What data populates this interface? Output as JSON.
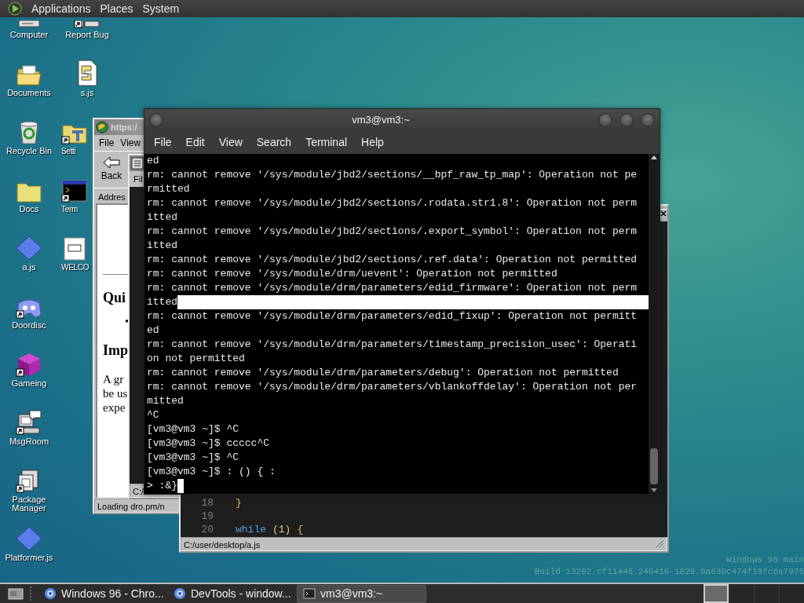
{
  "top_panel": {
    "menus": [
      "Applications",
      "Places",
      "System"
    ]
  },
  "desktop_icons": [
    {
      "label": "Computer",
      "kind": "computer",
      "shortcut": false,
      "partly_hidden": false
    },
    {
      "label": "Documents",
      "kind": "folder-open",
      "shortcut": false,
      "partly_hidden": false
    },
    {
      "label": "Recycle Bin",
      "kind": "recycle-bin",
      "shortcut": false,
      "partly_hidden": false
    },
    {
      "label": "Docs",
      "kind": "folder",
      "shortcut": false,
      "partly_hidden": false
    },
    {
      "label": "a.js",
      "kind": "diamond",
      "shortcut": false,
      "partly_hidden": false
    },
    {
      "label": "Doordisc",
      "kind": "controller",
      "shortcut": true,
      "partly_hidden": false
    },
    {
      "label": "Gameing",
      "kind": "cube",
      "shortcut": true,
      "partly_hidden": false
    },
    {
      "label": "MsgRoom",
      "kind": "chat-computer",
      "shortcut": true,
      "partly_hidden": false
    },
    {
      "label": "Package Manager",
      "kind": "package",
      "shortcut": true,
      "partly_hidden": false
    },
    {
      "label": "Platformer.js",
      "kind": "diamond",
      "shortcut": false,
      "partly_hidden": false
    },
    {
      "label": "Report Bug",
      "kind": "report",
      "shortcut": true,
      "partly_hidden": false
    },
    {
      "label": "s.js",
      "kind": "script",
      "shortcut": false,
      "partly_hidden": false
    },
    {
      "label": "Setti",
      "kind": "settings",
      "shortcut": true,
      "partly_hidden": true
    },
    {
      "label": "Term",
      "kind": "terminal",
      "shortcut": true,
      "partly_hidden": true
    },
    {
      "label": "WELCO",
      "kind": "document",
      "shortcut": false,
      "partly_hidden": true
    }
  ],
  "browser_window": {
    "title": "https:/",
    "menu": [
      "File",
      "View"
    ],
    "back_button": "Back",
    "address_label": "Addres",
    "heading_1": "Qui",
    "bullet": "•",
    "heading_2": "Imp",
    "paragraph_lines": [
      "A gr",
      "be us",
      "expe"
    ],
    "status": "Loading dro.pm/n"
  },
  "file_window": {
    "menu": [
      "Fil"
    ],
    "status": "C:/"
  },
  "editor_window": {
    "lines": [
      {
        "number": "18",
        "tokens": [
          {
            "text": "}",
            "kind": "brace"
          }
        ]
      },
      {
        "number": "19"
      },
      {
        "number": "20",
        "tokens": [
          {
            "text": "while",
            "kind": "keyword"
          },
          {
            "text": "(1)",
            "kind": "paren"
          },
          {
            "text": "{",
            "kind": "brace"
          }
        ]
      }
    ],
    "status": "C:/user/desktop/a.js"
  },
  "terminal": {
    "title": "vm3@vm3:~",
    "menu": [
      "File",
      "Edit",
      "View",
      "Search",
      "Terminal",
      "Help"
    ],
    "lines": [
      {
        "text": "ed",
        "highlight": false,
        "cursor": false
      },
      {
        "text": "rm: cannot remove '/sys/module/jbd2/sections/__bpf_raw_tp_map': Operation not pe",
        "highlight": false,
        "cursor": false
      },
      {
        "text": "rmitted",
        "highlight": false,
        "cursor": false
      },
      {
        "text": "rm: cannot remove '/sys/module/jbd2/sections/.rodata.str1.8': Operation not perm",
        "highlight": false,
        "cursor": false
      },
      {
        "text": "itted",
        "highlight": false,
        "cursor": false
      },
      {
        "text": "rm: cannot remove '/sys/module/jbd2/sections/.export_symbol': Operation not perm",
        "highlight": false,
        "cursor": false
      },
      {
        "text": "itted",
        "highlight": false,
        "cursor": false
      },
      {
        "text": "rm: cannot remove '/sys/module/jbd2/sections/.ref.data': Operation not permitted",
        "highlight": false,
        "cursor": false
      },
      {
        "text": "rm: cannot remove '/sys/module/drm/uevent': Operation not permitted",
        "highlight": false,
        "cursor": false
      },
      {
        "text": "rm: cannot remove '/sys/module/drm/parameters/edid_firmware': Operation not perm",
        "highlight": false,
        "cursor": false
      },
      {
        "text": "itted",
        "highlight": true,
        "cursor": false
      },
      {
        "text": "rm: cannot remove '/sys/module/drm/parameters/edid_fixup': Operation not permitt",
        "highlight": false,
        "cursor": false
      },
      {
        "text": "ed",
        "highlight": false,
        "cursor": false
      },
      {
        "text": "rm: cannot remove '/sys/module/drm/parameters/timestamp_precision_usec': Operati",
        "highlight": false,
        "cursor": false
      },
      {
        "text": "on not permitted",
        "highlight": false,
        "cursor": false
      },
      {
        "text": "rm: cannot remove '/sys/module/drm/parameters/debug': Operation not permitted",
        "highlight": false,
        "cursor": false
      },
      {
        "text": "rm: cannot remove '/sys/module/drm/parameters/vblankoffdelay': Operation not per",
        "highlight": false,
        "cursor": false
      },
      {
        "text": "mitted",
        "highlight": false,
        "cursor": false
      },
      {
        "text": "^C",
        "highlight": false,
        "cursor": false
      },
      {
        "text": "[vm3@vm3 ~]$ ^C",
        "highlight": false,
        "cursor": false
      },
      {
        "text": "[vm3@vm3 ~]$ ccccc^C",
        "highlight": false,
        "cursor": false
      },
      {
        "text": "[vm3@vm3 ~]$ ^C",
        "highlight": false,
        "cursor": false
      },
      {
        "text": "[vm3@vm3 ~]$ : () { :",
        "highlight": false,
        "cursor": false
      },
      {
        "text": "> :&}",
        "highlight": false,
        "cursor": true
      }
    ]
  },
  "build_info": [
    "Windows 96 main",
    "Build 13202.cf11448.240410-1828.0a630c474f19fc6a7975"
  ],
  "taskbar": {
    "tasks": [
      {
        "label": "Windows 96 - Chro...",
        "kind": "browser",
        "selected": false
      },
      {
        "label": "DevTools - window...",
        "kind": "browser",
        "selected": false
      },
      {
        "label": "vm3@vm3:~",
        "kind": "terminal",
        "selected": true
      }
    ],
    "workspaces": [
      {
        "selected": true
      },
      {
        "selected": false
      },
      {
        "selected": false
      },
      {
        "selected": false
      }
    ]
  }
}
